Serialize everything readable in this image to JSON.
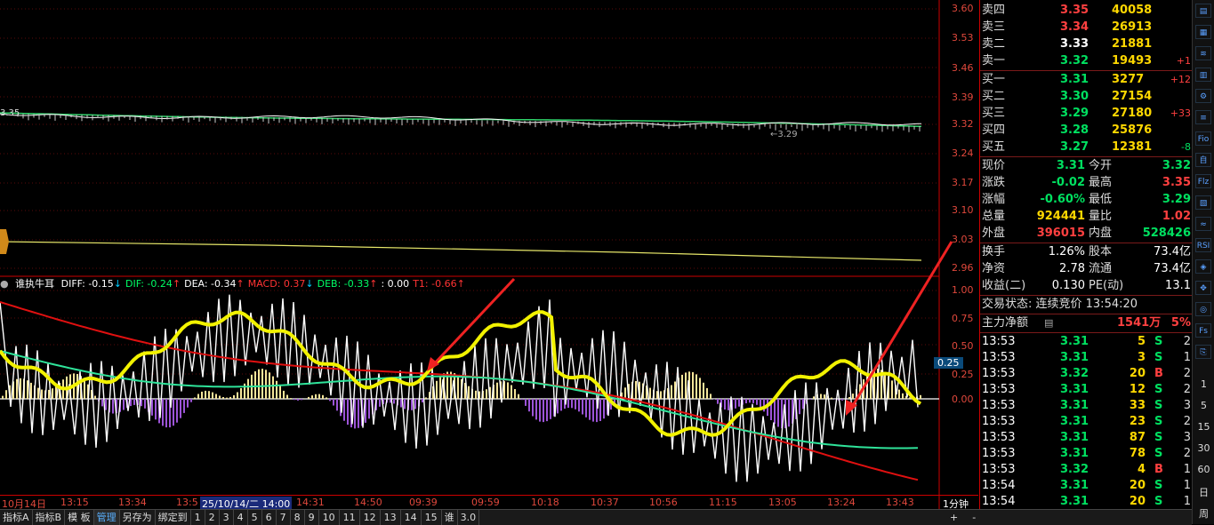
{
  "price_axis": [
    "3.60",
    "3.53",
    "3.46",
    "3.39",
    "3.32",
    "3.24",
    "3.17",
    "3.10",
    "3.03",
    "2.96"
  ],
  "macd_axis": [
    "1.00",
    "0.75",
    "0.50",
    "0.25",
    "0.00"
  ],
  "macd_current_tag": "0.25",
  "left_price_tag": "3.35",
  "min_price_tag": "←3.29",
  "indicator": {
    "name": "谁执牛耳",
    "items": [
      {
        "text": "DIFF: -0.15",
        "arrow": "↓",
        "color": "#ffffff"
      },
      {
        "text": "DIF: -0.24",
        "arrow": "↑",
        "color": "#00ff66"
      },
      {
        "text": "DEA: -0.34",
        "arrow": "↑",
        "color": "#ffffff"
      },
      {
        "text": "MACD: 0.37",
        "arrow": "↓",
        "color": "#ff3333"
      },
      {
        "text": "DEB: -0.33",
        "arrow": "↑",
        "color": "#00ff66"
      },
      {
        "text": ": 0.00",
        "arrow": "",
        "color": "#ffffff"
      },
      {
        "text": "T1: -0.66",
        "arrow": "↑",
        "color": "#ff3333"
      }
    ]
  },
  "time_labels": [
    "10月14日",
    "13:15",
    "13:34",
    "13:5",
    "25/10/14/二 14:00",
    "14:31",
    "14:50",
    "09:39",
    "09:59",
    "10:18",
    "10:37",
    "10:56",
    "11:15",
    "13:05",
    "13:24",
    "13:43"
  ],
  "period_label": "1分钟",
  "bottom_tabs": [
    "指标A",
    "指标B",
    "模 板",
    "管理",
    "另存为",
    "绑定到",
    "1",
    "2",
    "3",
    "4",
    "5",
    "6",
    "7",
    "8",
    "9",
    "10",
    "11",
    "12",
    "13",
    "14",
    "15",
    "谁",
    "3.0"
  ],
  "zoom_buttons": [
    "+",
    "-"
  ],
  "order_book": {
    "asks": [
      {
        "label": "卖四",
        "price": "3.35",
        "vol": "40058",
        "chg": "",
        "pc": "#ff4040"
      },
      {
        "label": "卖三",
        "price": "3.34",
        "vol": "26913",
        "chg": "",
        "pc": "#ff4040"
      },
      {
        "label": "卖二",
        "price": "3.33",
        "vol": "21881",
        "chg": "",
        "pc": "#ffffff"
      },
      {
        "label": "卖一",
        "price": "3.32",
        "vol": "19493",
        "chg": "+1",
        "pc": "#00e060"
      }
    ],
    "bids": [
      {
        "label": "买一",
        "price": "3.31",
        "vol": "3277",
        "chg": "+12",
        "pc": "#00e060"
      },
      {
        "label": "买二",
        "price": "3.30",
        "vol": "27154",
        "chg": "",
        "pc": "#00e060"
      },
      {
        "label": "买三",
        "price": "3.29",
        "vol": "27180",
        "chg": "+33",
        "pc": "#00e060"
      },
      {
        "label": "买四",
        "price": "3.28",
        "vol": "25876",
        "chg": "",
        "pc": "#00e060"
      },
      {
        "label": "买五",
        "price": "3.27",
        "vol": "12381",
        "chg": "-8",
        "pc": "#00e060"
      }
    ]
  },
  "quote": [
    {
      "l1": "现价",
      "v1": "3.31",
      "c1": "#00e060",
      "l2": "今开",
      "v2": "3.32",
      "c2": "#00e060"
    },
    {
      "l1": "涨跌",
      "v1": "-0.02",
      "c1": "#00e060",
      "l2": "最高",
      "v2": "3.35",
      "c2": "#ff4040"
    },
    {
      "l1": "涨幅",
      "v1": "-0.60%",
      "c1": "#00e060",
      "l2": "最低",
      "v2": "3.29",
      "c2": "#00e060"
    },
    {
      "l1": "总量",
      "v1": "924441",
      "c1": "#ffd800",
      "l2": "量比",
      "v2": "1.02",
      "c2": "#ff4040"
    },
    {
      "l1": "外盘",
      "v1": "396015",
      "c1": "#ff4040",
      "l2": "内盘",
      "v2": "528426",
      "c2": "#00e060"
    }
  ],
  "fundamentals": [
    {
      "l1": "换手",
      "v1": "1.26%",
      "l2": "股本",
      "v2": "73.4亿"
    },
    {
      "l1": "净资",
      "v1": "2.78",
      "l2": "流通",
      "v2": "73.4亿"
    },
    {
      "l1": "收益(二)",
      "v1": "0.130",
      "l2": "PE(动)",
      "v2": "13.1"
    }
  ],
  "trade_status": "交易状态: 连续竞价 13:54:20",
  "main_force": {
    "label": "主力净额",
    "value": "1541万",
    "pct": "5%"
  },
  "ticks": [
    {
      "t": "13:53",
      "p": "3.31",
      "v": "5",
      "s": "S",
      "n": "2",
      "pc": "#00e060"
    },
    {
      "t": "13:53",
      "p": "3.31",
      "v": "3",
      "s": "S",
      "n": "1",
      "pc": "#00e060"
    },
    {
      "t": "13:53",
      "p": "3.32",
      "v": "20",
      "s": "B",
      "n": "2",
      "pc": "#00e060"
    },
    {
      "t": "13:53",
      "p": "3.31",
      "v": "12",
      "s": "S",
      "n": "2",
      "pc": "#00e060"
    },
    {
      "t": "13:53",
      "p": "3.31",
      "v": "33",
      "s": "S",
      "n": "3",
      "pc": "#00e060"
    },
    {
      "t": "13:53",
      "p": "3.31",
      "v": "23",
      "s": "S",
      "n": "2",
      "pc": "#00e060"
    },
    {
      "t": "13:53",
      "p": "3.31",
      "v": "87",
      "s": "S",
      "n": "3",
      "pc": "#00e060"
    },
    {
      "t": "13:53",
      "p": "3.31",
      "v": "78",
      "s": "S",
      "n": "2",
      "pc": "#00e060"
    },
    {
      "t": "13:53",
      "p": "3.32",
      "v": "4",
      "s": "B",
      "n": "1",
      "pc": "#00e060"
    },
    {
      "t": "13:54",
      "p": "3.31",
      "v": "20",
      "s": "S",
      "n": "1",
      "pc": "#00e060"
    },
    {
      "t": "13:54",
      "p": "3.31",
      "v": "20",
      "s": "S",
      "n": "1",
      "pc": "#00e060"
    }
  ],
  "side_icons": [
    "▤",
    "▦",
    "≋",
    "▥",
    "⚙",
    "≡",
    "Fio",
    "自",
    "Flz",
    "▧",
    "≈",
    "RSI",
    "◈",
    "✥",
    "◎",
    "Fs",
    "⎘"
  ],
  "side_text": [
    "1",
    "5",
    "15",
    "30",
    "60",
    "日",
    "周"
  ]
}
